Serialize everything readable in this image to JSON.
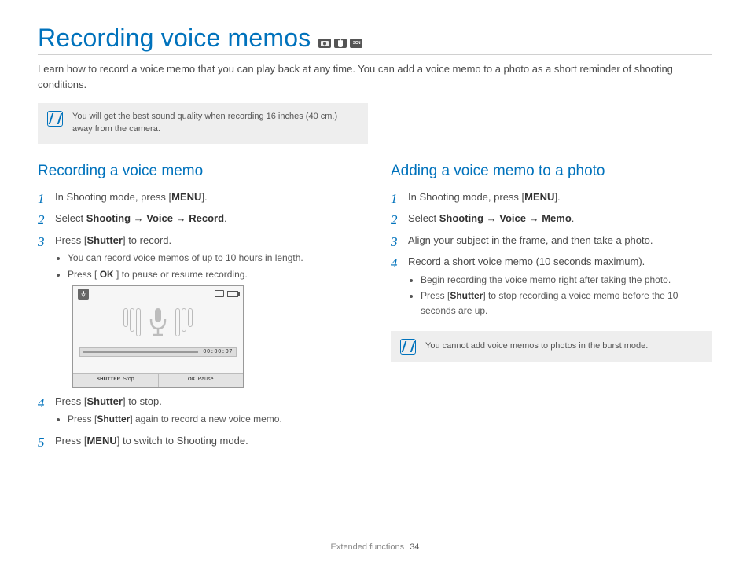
{
  "title": "Recording voice memos",
  "intro": "Learn how to record a voice memo that you can play back at any time. You can add a voice memo to a photo as a short reminder of shooting conditions.",
  "top_note": "You will get the best sound quality when recording 16 inches (40 cm.) away from the camera.",
  "left": {
    "heading": "Recording a voice memo",
    "step1_pre": "In Shooting mode, press [",
    "step1_b": "MENU",
    "step1_post": "].",
    "step2_pre": "Select ",
    "step2_b": "Shooting → Voice → Record",
    "step2_post": ".",
    "step3_pre": "Press [",
    "step3_b": "Shutter",
    "step3_post": "] to record.",
    "step3_sub1": "You can record voice memos of up to 10 hours in length.",
    "step3_sub2_pre": "Press [ ",
    "step3_sub2_b": "OK",
    "step3_sub2_post": " ] to pause or resume recording.",
    "step4_pre": "Press [",
    "step4_b": "Shutter",
    "step4_post": "] to stop.",
    "step4_sub_pre": "Press [",
    "step4_sub_b": "Shutter",
    "step4_sub_post": "] again to record a new voice memo.",
    "step5_pre": "Press [",
    "step5_b": "MENU",
    "step5_post": "] to switch to Shooting mode."
  },
  "screen": {
    "time": "00:00:07",
    "shutter_label": "SHUTTER",
    "stop": "Stop",
    "ok_label": "OK",
    "pause": "Pause"
  },
  "right": {
    "heading": "Adding a voice memo to a photo",
    "step1_pre": "In Shooting mode, press [",
    "step1_b": "MENU",
    "step1_post": "].",
    "step2_pre": "Select ",
    "step2_b": "Shooting → Voice → Memo",
    "step2_post": ".",
    "step3": "Align your subject in the frame, and then take a photo.",
    "step4": "Record a short voice memo (10 seconds maximum).",
    "step4_sub1": "Begin recording the voice memo right after taking the photo.",
    "step4_sub2_pre": "Press [",
    "step4_sub2_b": "Shutter",
    "step4_sub2_post": "] to stop recording a voice memo before the 10 seconds are up.",
    "note": "You cannot add voice memos to photos in the burst mode."
  },
  "footer": {
    "section": "Extended functions",
    "page": "34"
  }
}
